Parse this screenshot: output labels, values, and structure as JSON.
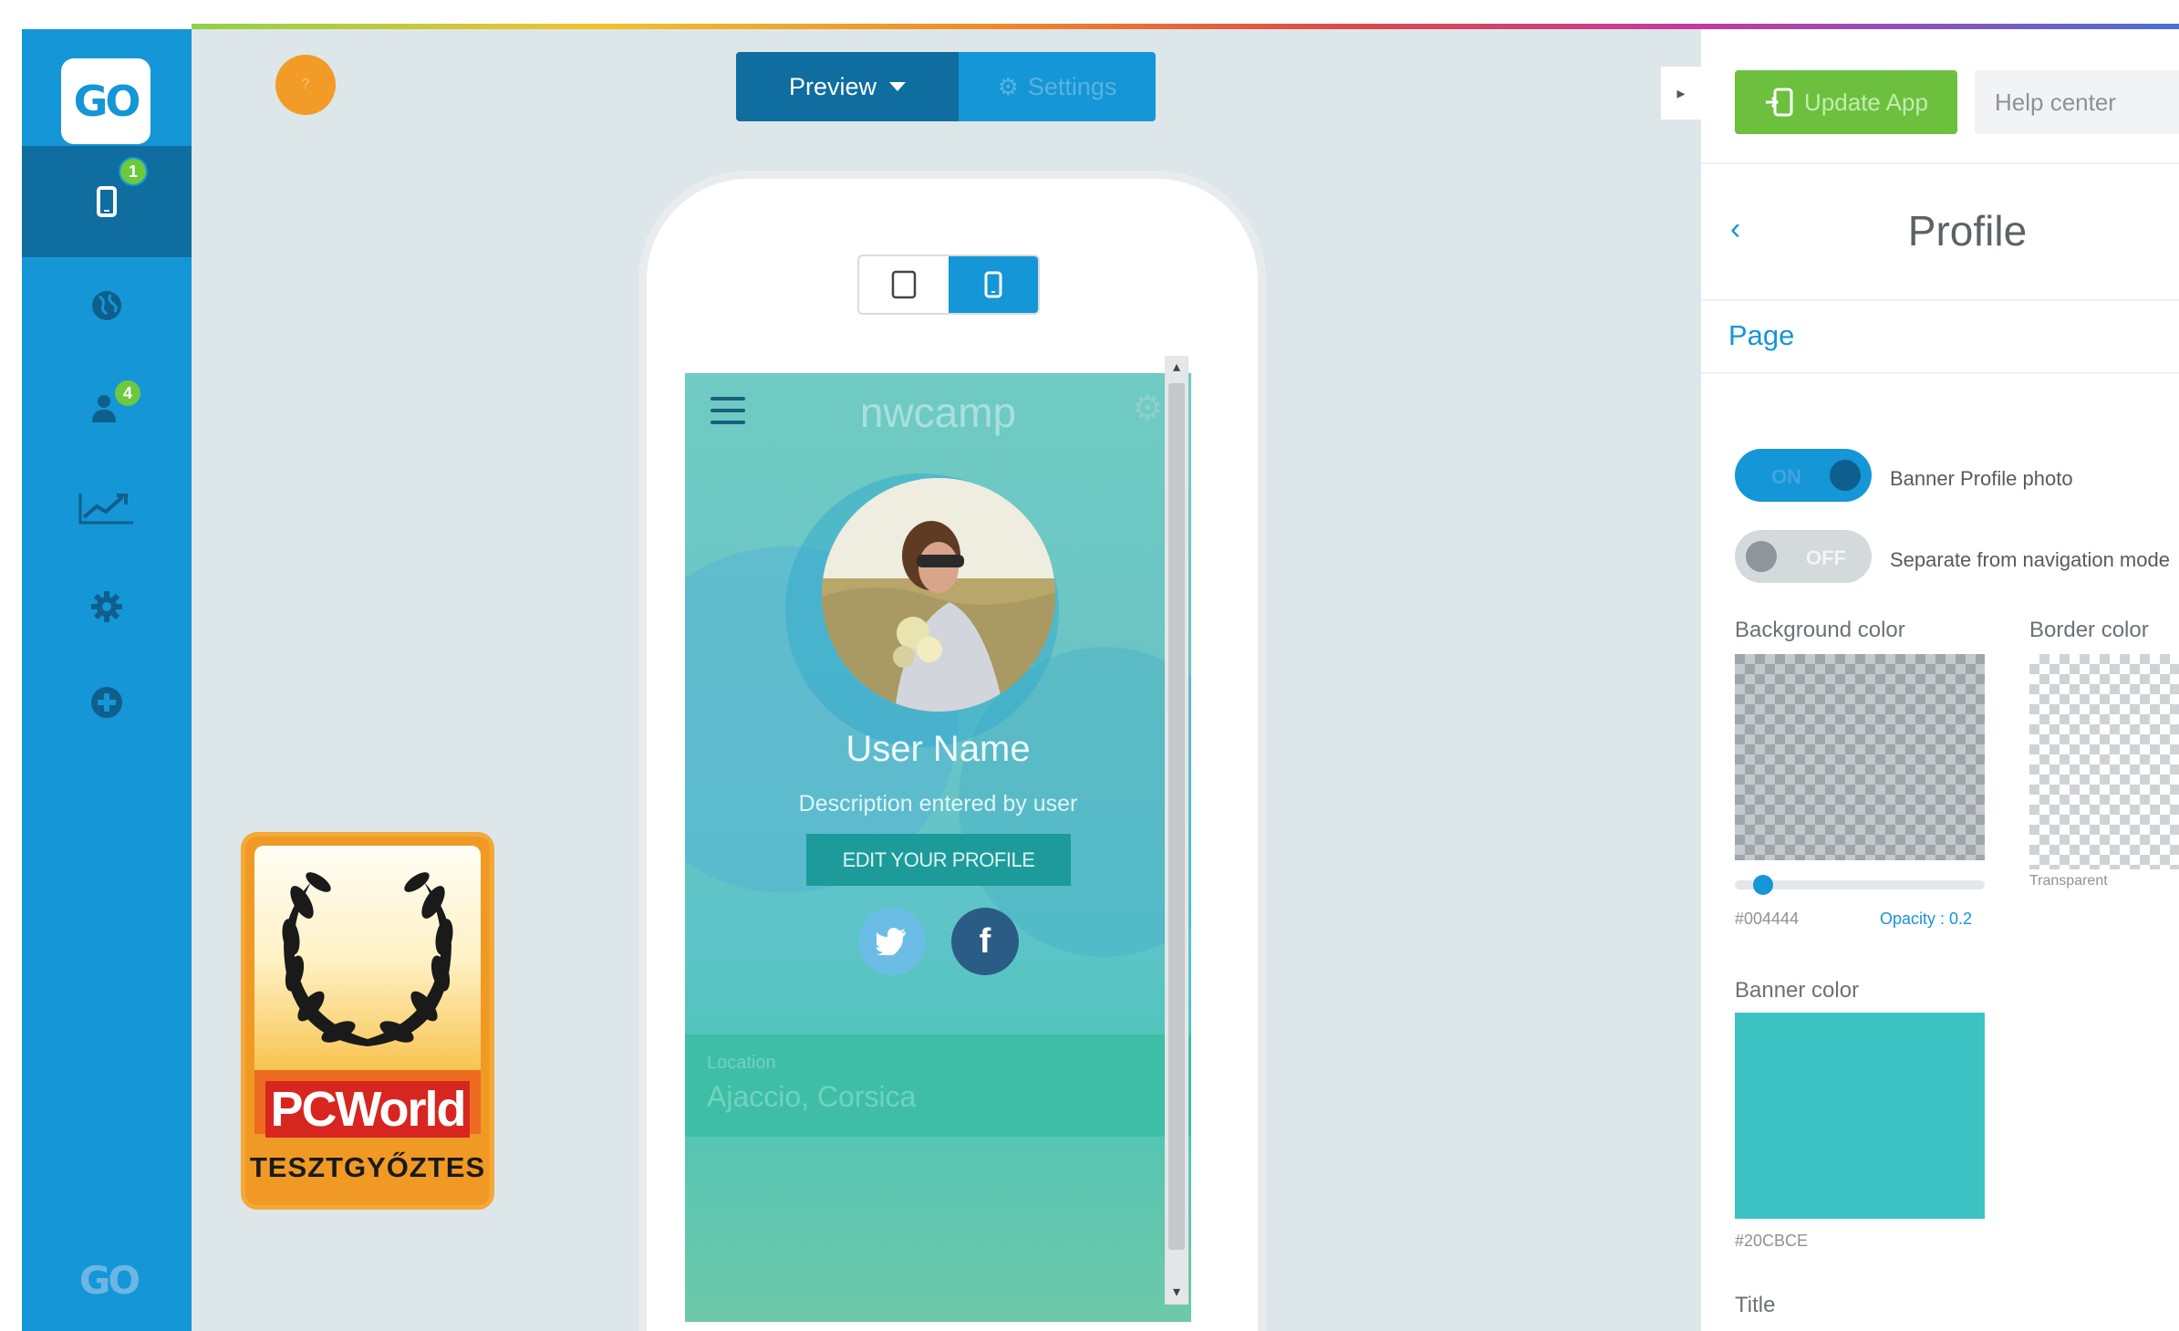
{
  "colors": {
    "sidebar": "#1596d6",
    "sidebar_active": "#0f6da0",
    "accent_green": "#6cc03e",
    "banner": "#20CBCE"
  },
  "sidebar": {
    "logo_text": "GO",
    "items": [
      {
        "icon": "smartphone-icon",
        "badge": "1"
      },
      {
        "icon": "globe-icon"
      },
      {
        "icon": "users-icon",
        "badge": "4"
      },
      {
        "icon": "chart-line-icon"
      },
      {
        "icon": "gear-icon"
      },
      {
        "icon": "plus-circle-icon"
      }
    ],
    "footer_logo_text": "GO"
  },
  "toolbar": {
    "preview_label": "Preview",
    "settings_label": "Settings"
  },
  "phone_app": {
    "app_title": "nwcamp",
    "user_name": "User Name",
    "user_description": "Description entered by user",
    "edit_button": "EDIT YOUR PROFILE",
    "location_label": "Location",
    "location_value": "Ajaccio, Corsica"
  },
  "badge": {
    "brand": "PCWorld",
    "subtitle": "TESZTGYŐZTES"
  },
  "right_panel": {
    "update_button": "Update App",
    "help_button": "Help center",
    "title": "Profile",
    "section_tab": "Page",
    "toggles": [
      {
        "state": "ON",
        "label": "Banner Profile photo"
      },
      {
        "state": "OFF",
        "label": "Separate from navigation mode"
      }
    ],
    "background_color": {
      "label": "Background color",
      "hex": "#004444",
      "opacity_text": "Opacity : 0.2",
      "opacity": 0.2
    },
    "border_color": {
      "label": "Border color",
      "value": "Transparent"
    },
    "banner_color": {
      "label": "Banner color",
      "hex": "#20CBCE"
    },
    "next_field_label": "Title"
  }
}
